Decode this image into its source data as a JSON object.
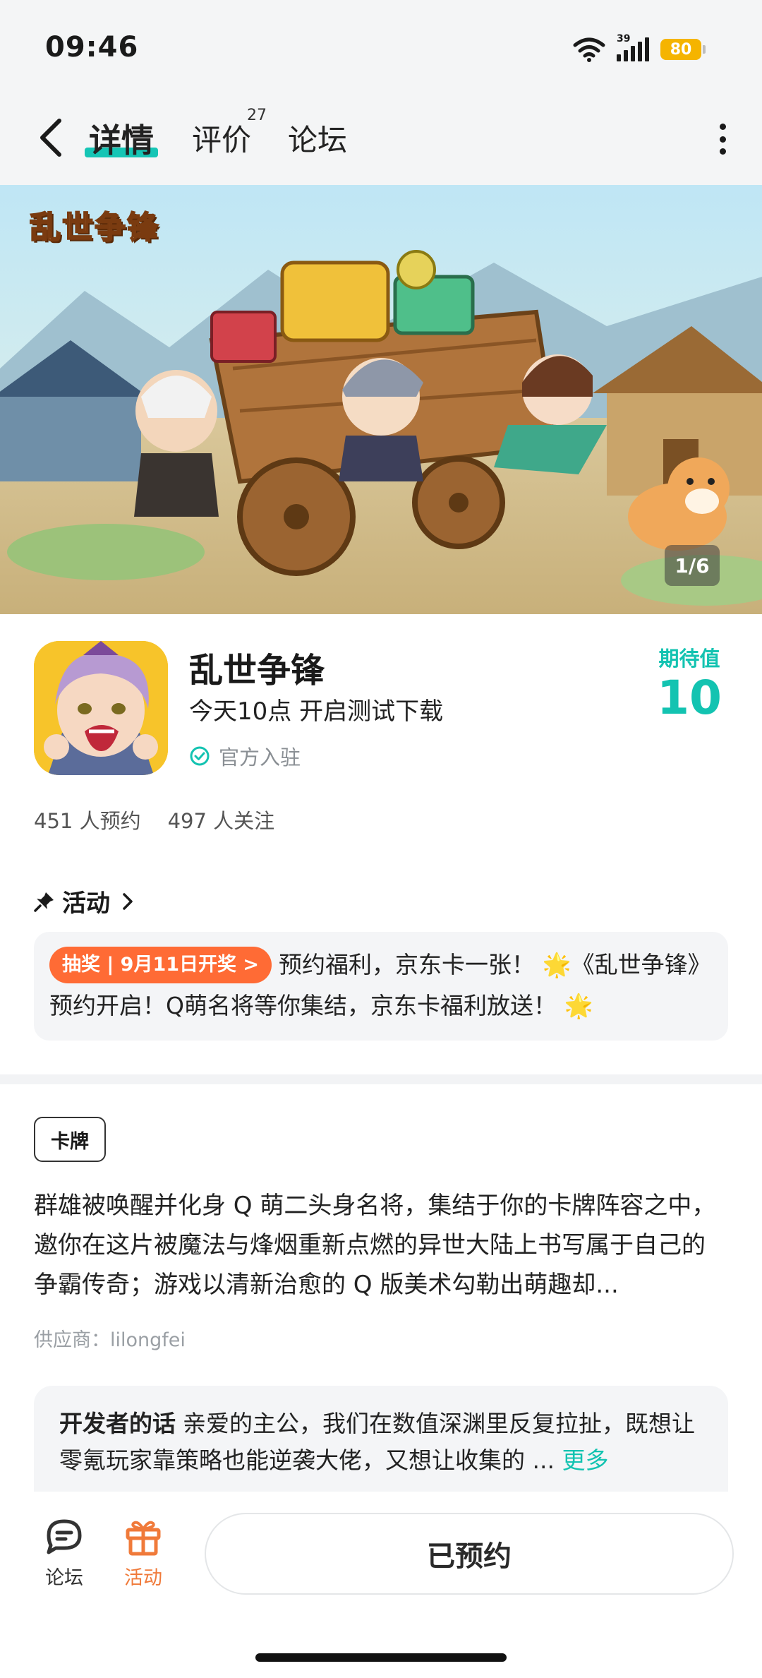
{
  "status_bar": {
    "time": "09:46",
    "network": "39",
    "battery": "80"
  },
  "nav": {
    "tab_details": "详情",
    "tab_reviews": "评价",
    "reviews_count": "27",
    "tab_forum": "论坛"
  },
  "banner": {
    "logo_text": "乱世争锋",
    "pager": "1/6"
  },
  "game": {
    "name": "乱世争锋",
    "subtitle": "今天10点 开启测试下载",
    "official": "官方入驻",
    "expect_label": "期待值",
    "expect_value": "10",
    "reservations": "451 人预约",
    "followers": "497 人关注"
  },
  "activity": {
    "heading": "活动",
    "tag": "抽奖 | 9月11日开奖 >",
    "text": "预约福利，京东卡一张！ 🌟《乱世争锋》预约开启！Q萌名将等你集结，京东卡福利放送！ 🌟"
  },
  "description": {
    "genre": "卡牌",
    "text": "群雄被唤醒并化身 Q 萌二头身名将，集结于你的卡牌阵容之中，邀你在这片被魔法与烽烟重新点燃的异世大陆上书写属于自己的争霸传奇；游戏以清新治愈的 Q 版美术勾勒出萌趣却...",
    "supplier": "供应商：lilongfei"
  },
  "developer": {
    "title": "开发者的话",
    "text": "亲爱的主公，我们在数值深渊里反复拉扯，既想让零氪玩家靠策略也能逆袭大佬，又想让收集的 ... ",
    "more": "更多"
  },
  "bottom_bar": {
    "forum": "论坛",
    "activity": "活动",
    "reserve_button": "已预约"
  },
  "colors": {
    "accent": "#13c3b1",
    "orange": "#ff6b35",
    "activity_icon": "#f07a3a"
  }
}
